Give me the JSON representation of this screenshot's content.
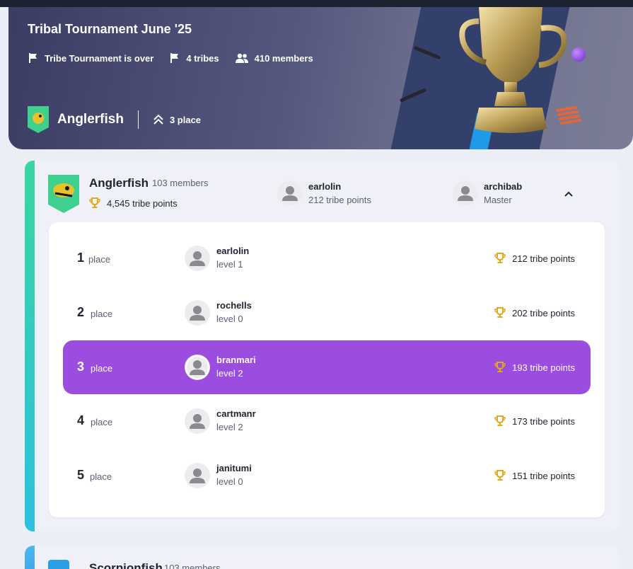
{
  "hero": {
    "title": "Tribal Tournament June '25",
    "status": "Tribe Tournament is over",
    "tribes": "4 tribes",
    "members": "410 members",
    "tribe_name": "Anglerfish",
    "place": "3 place"
  },
  "tribe_card": {
    "name": "Anglerfish",
    "members": "103 members",
    "points": "4,545 tribe points",
    "leaders": [
      {
        "name": "earlolin",
        "sub": "212 tribe points"
      },
      {
        "name": "archibab",
        "sub": "Master"
      }
    ],
    "rows": [
      {
        "rank": "1",
        "place_label": "place",
        "user": "earlolin",
        "level": "level 1",
        "points": "212 tribe points",
        "active": false
      },
      {
        "rank": "2",
        "place_label": "place",
        "user": "rochells",
        "level": "level 0",
        "points": "202 tribe points",
        "active": false
      },
      {
        "rank": "3",
        "place_label": "place",
        "user": "branmari",
        "level": "level 2",
        "points": "193 tribe points",
        "active": true
      },
      {
        "rank": "4",
        "place_label": "place",
        "user": "cartmanr",
        "level": "level 2",
        "points": "173 tribe points",
        "active": false
      },
      {
        "rank": "5",
        "place_label": "place",
        "user": "janitumi",
        "level": "level 0",
        "points": "151 tribe points",
        "active": false
      }
    ]
  },
  "next_card": {
    "name": "Scorpionfish",
    "members": "103 members"
  },
  "colors": {
    "accent_purple": "#9b4de0",
    "trophy_gold": "#e0a81a",
    "tribe_accent": "#38d6a0"
  },
  "icons": [
    "flag-icon",
    "users-icon",
    "double-chevron-up-icon",
    "trophy-icon",
    "chevron-up-icon",
    "avatar-icon"
  ]
}
